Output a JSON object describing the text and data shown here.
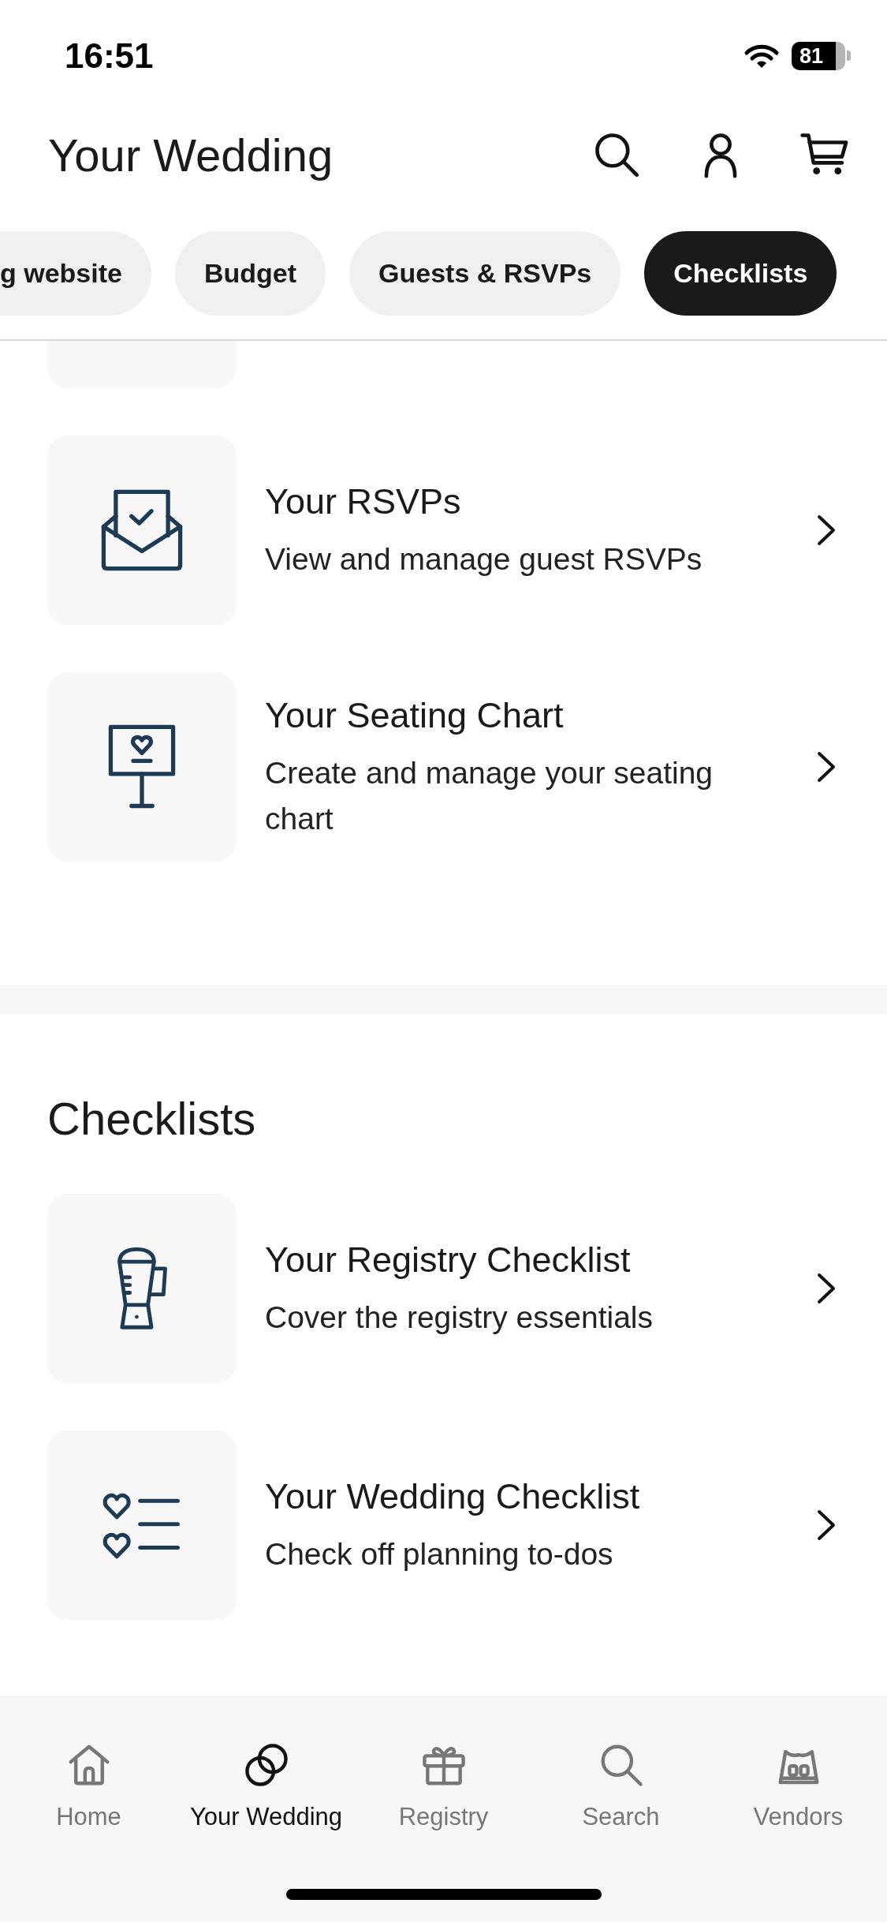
{
  "status_bar": {
    "time": "16:51",
    "battery": "81"
  },
  "header": {
    "title": "Your Wedding"
  },
  "chips": [
    {
      "label": "g website",
      "selected": false
    },
    {
      "label": "Budget",
      "selected": false
    },
    {
      "label": "Guests & RSVPs",
      "selected": false
    },
    {
      "label": "Checklists",
      "selected": true
    }
  ],
  "sections": [
    {
      "cards": [
        {
          "kind": "rsvps",
          "title": "Your RSVPs",
          "subtitle": "View and manage guest RSVPs"
        },
        {
          "kind": "seating",
          "title": "Your Seating Chart",
          "subtitle": "Create and manage your seating chart"
        }
      ]
    },
    {
      "heading": "Checklists",
      "cards": [
        {
          "kind": "registry",
          "title": "Your Registry Checklist",
          "subtitle": "Cover the registry essentials"
        },
        {
          "kind": "wedding",
          "title": "Your Wedding Checklist",
          "subtitle": "Check off planning to-dos"
        }
      ]
    }
  ],
  "tab_bar": [
    {
      "kind": "home",
      "label": "Home",
      "selected": false
    },
    {
      "kind": "wedding",
      "label": "Your Wedding",
      "selected": true
    },
    {
      "kind": "registry",
      "label": "Registry",
      "selected": false
    },
    {
      "kind": "search",
      "label": "Search",
      "selected": false
    },
    {
      "kind": "vendors",
      "label": "Vendors",
      "selected": false
    }
  ]
}
